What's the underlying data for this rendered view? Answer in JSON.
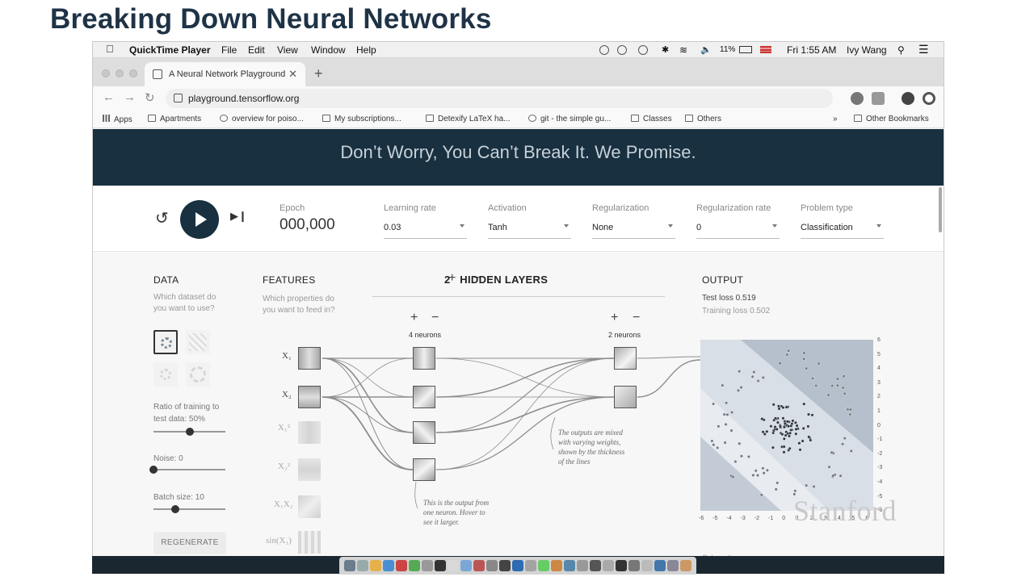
{
  "slide": {
    "title": "Breaking Down Neural Networks",
    "watermark": "Stanford"
  },
  "menubar": {
    "app": "QuickTime Player",
    "menus": [
      "File",
      "Edit",
      "View",
      "Window",
      "Help"
    ],
    "battery": "11%",
    "clock": "Fri 1:55 AM",
    "user": "Ivy Wang"
  },
  "browser": {
    "tab_title": "A Neural Network Playground",
    "url": "playground.tensorflow.org",
    "bookmarks": [
      "Apps",
      "Apartments",
      "overview for poiso...",
      "My subscriptions...",
      "Detexify LaTeX ha...",
      "git - the simple gu...",
      "Classes",
      "Others"
    ],
    "other_bookmarks": "Other Bookmarks"
  },
  "hero": {
    "text": "Don’t Worry, You Can’t Break It. We Promise."
  },
  "controls": {
    "epoch_label": "Epoch",
    "epoch_value": "000,000",
    "learning_rate": {
      "label": "Learning rate",
      "value": "0.03"
    },
    "activation": {
      "label": "Activation",
      "value": "Tanh"
    },
    "regularization": {
      "label": "Regularization",
      "value": "None"
    },
    "regularization_rate": {
      "label": "Regularization rate",
      "value": "0"
    },
    "problem_type": {
      "label": "Problem type",
      "value": "Classification"
    }
  },
  "data_panel": {
    "heading": "DATA",
    "sub": "Which dataset do you want to use?",
    "ratio_label": "Ratio of training to test data:  50%",
    "ratio_value": 0.5,
    "noise_label": "Noise:  0",
    "noise_value": 0,
    "batch_label": "Batch size:  10",
    "batch_value": 0.3,
    "regenerate": "REGENERATE"
  },
  "features_panel": {
    "heading": "FEATURES",
    "sub": "Which properties do you want to feed in?",
    "features": [
      "X₁",
      "X₂",
      "X₁²",
      "X₂²",
      "X₁X₂",
      "sin(X₁)"
    ]
  },
  "network": {
    "plus": "+",
    "minus": "−",
    "hidden_count": "2",
    "hidden_label": "HIDDEN LAYERS",
    "layer1_neurons": "4 neurons",
    "layer2_neurons": "2 neurons",
    "annotation_weights": "The outputs are mixed with varying weights, shown by the thickness of the lines",
    "annotation_neuron": "This is the output from one neuron. Hover to see it larger."
  },
  "output_panel": {
    "heading": "OUTPUT",
    "test_loss": "Test loss 0.519",
    "training_loss": "Training loss 0.502",
    "y_ticks": [
      "6",
      "5",
      "4",
      "3",
      "2",
      "1",
      "0",
      "-1",
      "-2",
      "-3",
      "-4",
      "-5",
      "-6"
    ],
    "x_ticks": [
      "-6",
      "-5",
      "-4",
      "-3",
      "-2",
      "-1",
      "0",
      "1",
      "2",
      "3",
      "4",
      "5",
      "6"
    ],
    "color_shows": "Colors shows"
  },
  "colors": {
    "hero_bg": "#183040",
    "orange": "#f59322",
    "blue": "#0877bd"
  }
}
